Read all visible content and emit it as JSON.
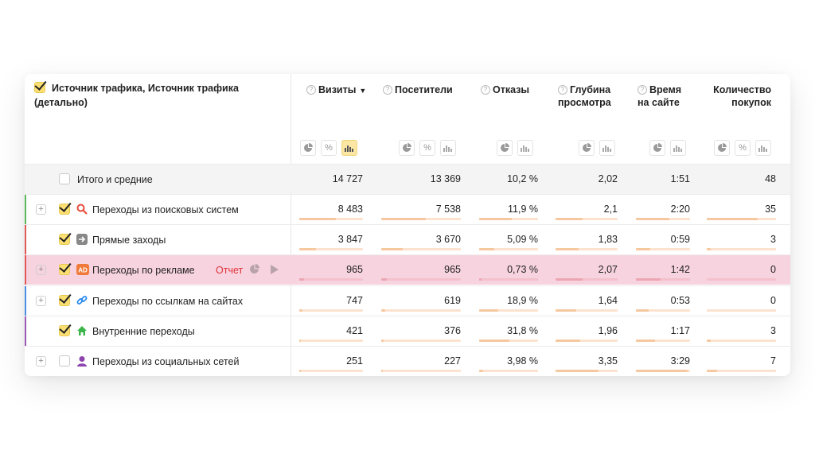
{
  "header": {
    "dimension_title": "Источник трафика, Источник трафика (детально)",
    "columns": [
      {
        "label": "Визиты",
        "sort": "▼"
      },
      {
        "label": "Посетители"
      },
      {
        "label": "Отказы"
      },
      {
        "label": "Глубина просмотра"
      },
      {
        "label": "Время на сайте"
      },
      {
        "label": "Количество покупок"
      }
    ],
    "percent_symbol": "%",
    "help_symbol": "?"
  },
  "total": {
    "label": "Итого и средние",
    "values": [
      "14 727",
      "13 369",
      "10,2 %",
      "2,02",
      "1:51",
      "48"
    ]
  },
  "rows": [
    {
      "label": "Переходы из поисковых систем",
      "values": [
        "8 483",
        "7 538",
        "11,9 %",
        "2,1",
        "2:20",
        "35"
      ],
      "bars": [
        0.58,
        0.56,
        0.55,
        0.43,
        0.62,
        0.73
      ],
      "marker_color": "#5cb85c",
      "icon": "search-icon"
    },
    {
      "label": "Прямые заходы",
      "values": [
        "3 847",
        "3 670",
        "5,09 %",
        "1,83",
        "0:59",
        "3"
      ],
      "bars": [
        0.26,
        0.27,
        0.26,
        0.37,
        0.26,
        0.06
      ],
      "marker_color": "#e05a5a",
      "icon": "arrow-right-icon"
    },
    {
      "label": "Переходы по рекламе",
      "values": [
        "965",
        "965",
        "0,73 %",
        "2,07",
        "1:42",
        "0"
      ],
      "bars": [
        0.07,
        0.07,
        0.04,
        0.43,
        0.46,
        0.0
      ],
      "marker_color": "#e05a5a",
      "icon": "ad-icon",
      "report_label": "Отчет",
      "highlight": true
    },
    {
      "label": "Переходы по ссылкам на сайтах",
      "values": [
        "747",
        "619",
        "18,9 %",
        "1,64",
        "0:53",
        "0"
      ],
      "bars": [
        0.05,
        0.05,
        0.32,
        0.33,
        0.24,
        0.0
      ],
      "marker_color": "#4a90e2",
      "icon": "link-icon"
    },
    {
      "label": "Внутренние переходы",
      "values": [
        "421",
        "376",
        "31,8 %",
        "1,96",
        "1:17",
        "3"
      ],
      "bars": [
        0.03,
        0.03,
        0.52,
        0.4,
        0.36,
        0.06
      ],
      "marker_color": "#9b59b6",
      "icon": "home-icon"
    },
    {
      "label": "Переходы из социальных сетей",
      "values": [
        "251",
        "227",
        "3,98 %",
        "3,35",
        "3:29",
        "7"
      ],
      "bars": [
        0.02,
        0.02,
        0.07,
        0.69,
        0.95,
        0.15
      ],
      "marker_color": "#ffffff",
      "icon": "person-icon"
    }
  ],
  "colors": {
    "accent": "#fcdf72",
    "highlight": "#f7d3df",
    "bar": "#f6c89f",
    "report": "#e0323a"
  }
}
